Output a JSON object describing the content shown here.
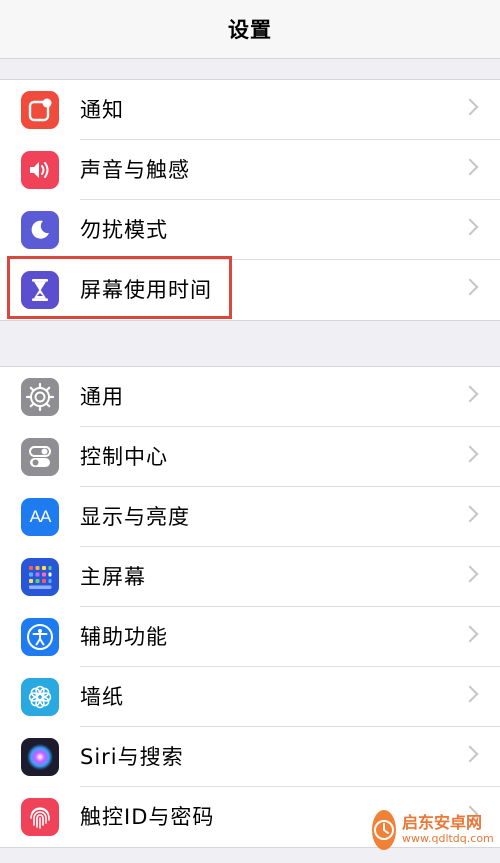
{
  "navbar": {
    "title": "设置"
  },
  "group1": [
    {
      "label": "通知",
      "icon": "notification-icon",
      "color": "#f04c3e"
    },
    {
      "label": "声音与触感",
      "icon": "sound-icon",
      "color": "#f0435a"
    },
    {
      "label": "勿扰模式",
      "icon": "moon-icon",
      "color": "#5b5bd6"
    },
    {
      "label": "屏幕使用时间",
      "icon": "hourglass-icon",
      "color": "#5b4fcf"
    }
  ],
  "group2": [
    {
      "label": "通用",
      "icon": "gear-icon",
      "color": "#8e8e93"
    },
    {
      "label": "控制中心",
      "icon": "toggles-icon",
      "color": "#8e8e93"
    },
    {
      "label": "显示与亮度",
      "icon": "text-size-icon",
      "color": "#1f7cf0"
    },
    {
      "label": "主屏幕",
      "icon": "home-grid-icon",
      "color": "#2756d8"
    },
    {
      "label": "辅助功能",
      "icon": "accessibility-icon",
      "color": "#1f7cf0"
    },
    {
      "label": "墙纸",
      "icon": "wallpaper-flower-icon",
      "color": "#2aa8e0"
    },
    {
      "label": "Siri与搜索",
      "icon": "siri-icon",
      "color": "#1c1c2e"
    },
    {
      "label": "触控ID与密码",
      "icon": "fingerprint-icon",
      "color": "#f0435a"
    }
  ],
  "icon_text": {
    "display": "AA"
  },
  "watermark": {
    "title": "启东安卓网",
    "url": "www.qdltdq.com"
  }
}
